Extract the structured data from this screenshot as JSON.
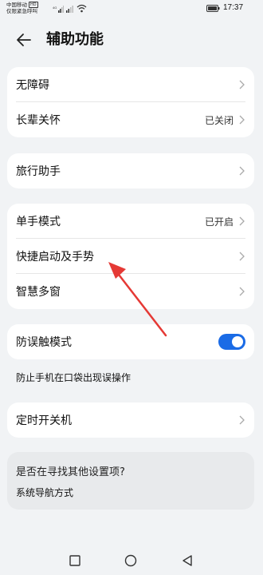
{
  "status_bar": {
    "carrier_line1": "中国移动",
    "hd_badge": "HD",
    "carrier_line2": "仅限紧急呼叫",
    "signal_label_1": "4G",
    "time": "17:37"
  },
  "header": {
    "title": "辅助功能"
  },
  "groups": {
    "g1": [
      {
        "label": "无障碍",
        "value": ""
      },
      {
        "label": "长辈关怀",
        "value": "已关闭"
      }
    ],
    "g2": [
      {
        "label": "旅行助手",
        "value": ""
      }
    ],
    "g3": [
      {
        "label": "单手模式",
        "value": "已开启"
      },
      {
        "label": "快捷启动及手势",
        "value": ""
      },
      {
        "label": "智慧多窗",
        "value": ""
      }
    ],
    "g4": {
      "label": "防误触模式",
      "toggle_on": true,
      "description": "防止手机在口袋出现误操作"
    },
    "g5": [
      {
        "label": "定时开关机",
        "value": ""
      }
    ]
  },
  "suggestion": {
    "title": "是否在寻找其他设置项?",
    "link": "系统导航方式"
  },
  "colors": {
    "accent": "#1a6be6",
    "annotation_arrow": "#e53935",
    "background": "#f1f3f5"
  },
  "icons": {
    "back": "arrow-left-icon",
    "chevron": "chevron-right-icon",
    "nav_back": "triangle-back-icon",
    "nav_home": "circle-home-icon",
    "nav_recent": "square-recent-icon"
  }
}
